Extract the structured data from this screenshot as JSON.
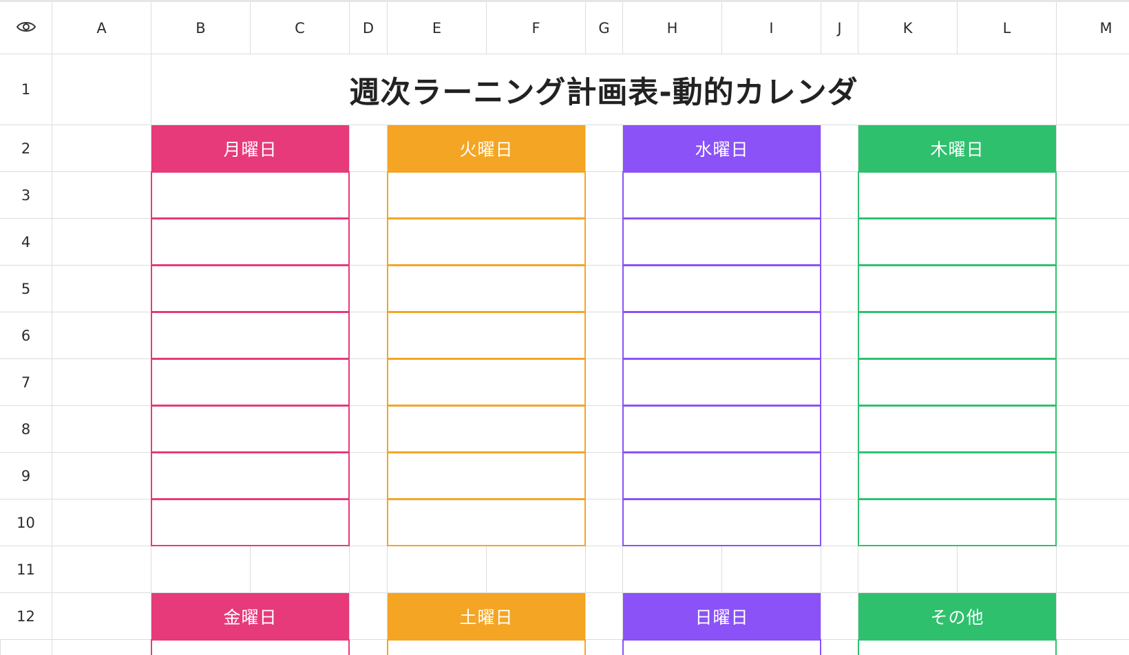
{
  "columns": [
    "A",
    "B",
    "C",
    "D",
    "E",
    "F",
    "G",
    "H",
    "I",
    "J",
    "K",
    "L",
    "M"
  ],
  "rows": [
    "1",
    "2",
    "3",
    "4",
    "5",
    "6",
    "7",
    "8",
    "9",
    "10",
    "11",
    "12"
  ],
  "corner_icon": "eye-icon",
  "title": "週次ラーニング計画表-動的カレンダ",
  "day_groups_row2": [
    {
      "label": "月曜日",
      "color": "#E63A7A"
    },
    {
      "label": "火曜日",
      "color": "#F4A523"
    },
    {
      "label": "水曜日",
      "color": "#8A52F7"
    },
    {
      "label": "木曜日",
      "color": "#2FC06E"
    }
  ],
  "day_groups_row12": [
    {
      "label": "金曜日",
      "color": "#E63A7A"
    },
    {
      "label": "土曜日",
      "color": "#F4A523"
    },
    {
      "label": "日曜日",
      "color": "#8A52F7"
    },
    {
      "label": "その他",
      "color": "#2FC06E"
    }
  ],
  "colors": {
    "grid": "#DCDCDC",
    "header_text": "#2B2B2B",
    "title_text": "#222222"
  }
}
